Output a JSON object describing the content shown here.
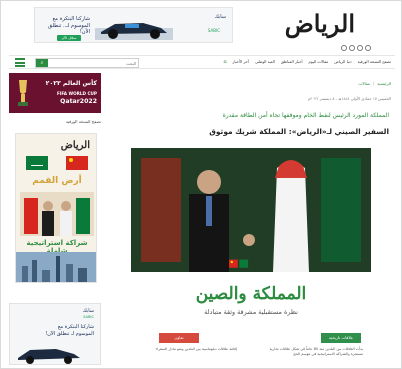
{
  "top_ad": {
    "text": "شاركنا البتكرة مع الموسوم لـ.. تنطلق الآن!",
    "cta": "سجّل الآن",
    "brand": "سابك",
    "brand_sub": "SABIC"
  },
  "logo": {
    "text": "الرياض"
  },
  "nav": {
    "search_placeholder": "البحث",
    "items": [
      "آخر الأخبار",
      "العيد الوطني",
      "أخبار المناطق",
      "مقالات اليوم",
      "دنيا الرياض",
      "تصفح النسخة الورقية"
    ]
  },
  "breadcrumb": {
    "home": "الرئيسية",
    "section": "مقالات"
  },
  "article": {
    "date": "الخميس ١٧ جمادى الأولى ١٤٤٤هـ - ٨ ديسمبر ٢٠٢٢م",
    "kicker": "المملكة المورد الرئيس لنفط الخام وموقفها تجاه أمن الطاقة مقدرة",
    "headline": "السفير الصيني لـ«الرياض»: المملكة شريك موثوق"
  },
  "promo": {
    "title": "المملكة والصين",
    "subtitle": "نظرة مستقبلية مشرقة وثقة متبادلة",
    "box_right": "علاقات تاريخية",
    "box_left": "تعاون",
    "text_right": "بدأت العلاقات بين البلدين منذ 80 عاماً في شكل علاقات تجارية مستمرة والشراكة الاستراتيجية في موسم الحج",
    "text_left": "إقامة علاقات دبلوماسية بين البلدين ونمو تبادل السفراء"
  },
  "side": {
    "wc_title": "كأس العالم ٢٠٢٢",
    "wc_sub": "FIFA WORLD CUP",
    "wc_year": "Qatar2022",
    "caption": "تصفح النسخة الورقية",
    "ad_logo": "الرياض",
    "ad_gold": "أرض القمم",
    "ad_green": "شراكة استراتيجية شاملة",
    "bottom_brand": "سابك",
    "bottom_sub": "SABIC",
    "bottom_text": "شاركنا البتكرة مع الموسوم لـ تنطلق الآن!"
  },
  "colors": {
    "accent": "#2c8c3f",
    "wc": "#6b1130",
    "gold": "#d3a43a",
    "red_box": "#d54a3d"
  }
}
